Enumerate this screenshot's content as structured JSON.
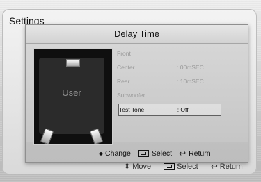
{
  "background": {
    "title": "Settings",
    "help": [
      {
        "icon": "up-down-arrows-icon",
        "label": "Move"
      },
      {
        "icon": "select-icon",
        "label": "Select"
      },
      {
        "icon": "return-icon",
        "label": "Return"
      }
    ]
  },
  "dialog": {
    "title": "Delay Time",
    "speaker_label": "User",
    "rows": [
      {
        "key": "Front",
        "value": ""
      },
      {
        "key": "Center",
        "value": ":  00mSEC"
      },
      {
        "key": "Rear",
        "value": ":  10mSEC"
      },
      {
        "key": "Subwoofer",
        "value": ""
      },
      {
        "key": "Test Tone",
        "value": ":  Off",
        "selected": true
      }
    ],
    "help": [
      {
        "icon": "left-right-arrows-icon",
        "label": "Change"
      },
      {
        "icon": "select-icon",
        "label": "Select"
      },
      {
        "icon": "return-icon",
        "label": "Return"
      }
    ]
  }
}
